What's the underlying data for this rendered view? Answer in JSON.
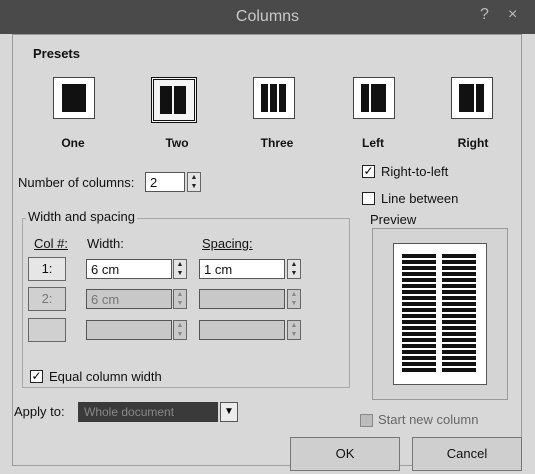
{
  "window": {
    "title": "Columns",
    "help_glyph": "?",
    "close_glyph": "×"
  },
  "presets": {
    "heading": "Presets",
    "items": [
      {
        "label": "One"
      },
      {
        "label": "Two"
      },
      {
        "label": "Three"
      },
      {
        "label": "Left"
      },
      {
        "label": "Right"
      }
    ],
    "selected": "Two"
  },
  "number_of_columns": {
    "label": "Number of columns:",
    "value": "2"
  },
  "options": {
    "right_to_left": {
      "label": "Right-to-left",
      "checked": true
    },
    "line_between": {
      "label": "Line between",
      "checked": false
    }
  },
  "width_spacing": {
    "heading": "Width and spacing",
    "col_header": "Col #:",
    "width_header": "Width:",
    "spacing_header": "Spacing:",
    "rows": [
      {
        "num": "1:",
        "width": "6 cm",
        "spacing": "1 cm"
      },
      {
        "num": "2:",
        "width": "6 cm",
        "spacing": ""
      },
      {
        "num": "",
        "width": "",
        "spacing": ""
      }
    ],
    "equal_width": {
      "label": "Equal column width",
      "checked": true
    }
  },
  "preview": {
    "label": "Preview"
  },
  "apply_to": {
    "label": "Apply to:",
    "value": "Whole document"
  },
  "start_new_column": {
    "label": "Start new column",
    "checked": false
  },
  "buttons": {
    "ok": "OK",
    "cancel": "Cancel"
  }
}
